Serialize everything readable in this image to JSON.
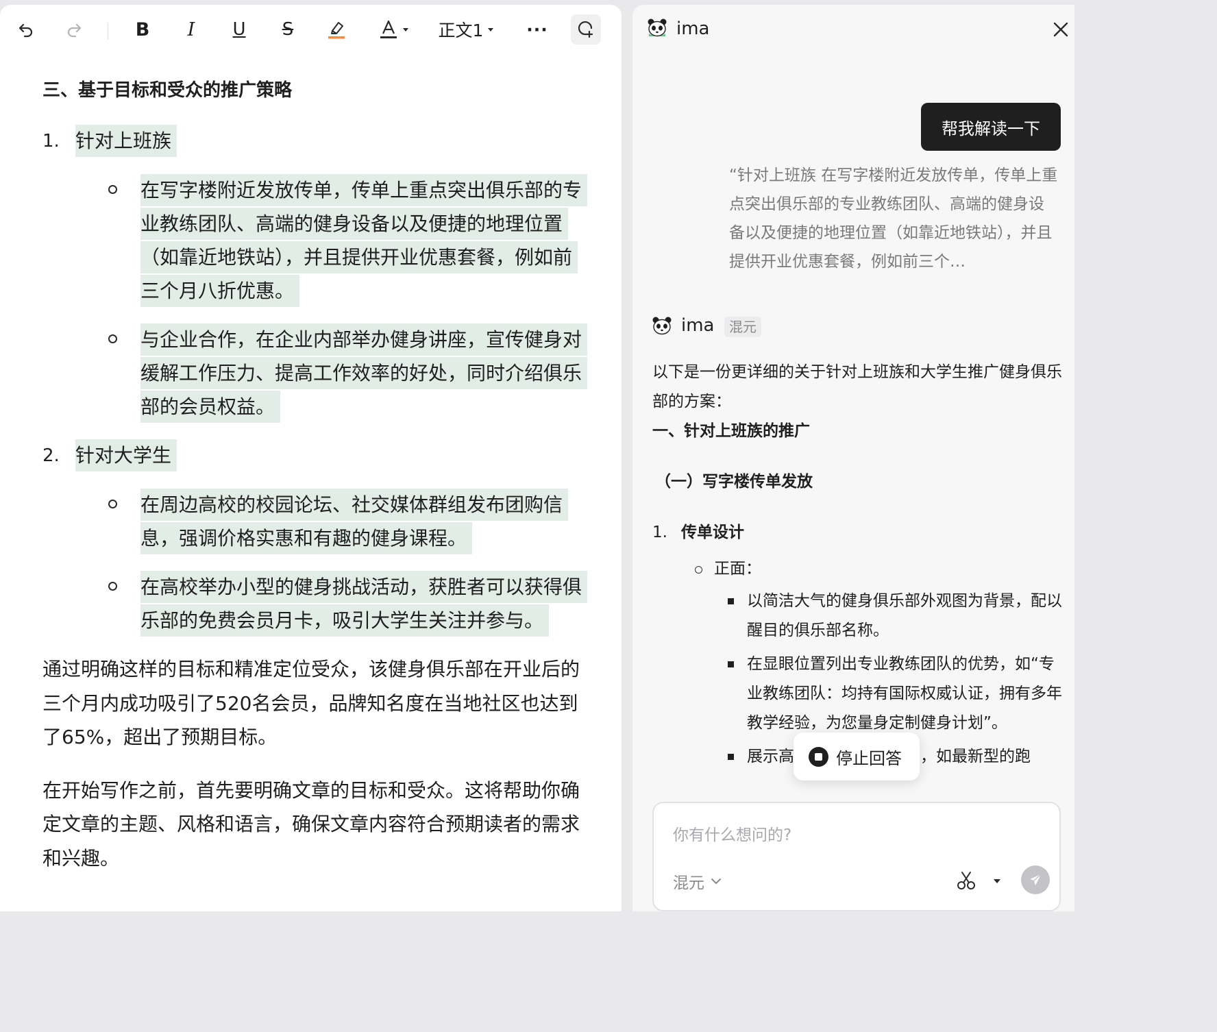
{
  "toolbar": {
    "undo_icon": "undo-icon",
    "redo_icon": "redo-icon",
    "bold_label": "B",
    "italic_label": "I",
    "underline_label": "U",
    "strike_label": "S",
    "style_select": "正文1",
    "more_label": "···",
    "highlight_color": "#ff8a3d"
  },
  "document": {
    "heading": "三、基于目标和受众的推广策略",
    "sections": [
      {
        "number": "1.",
        "title": "针对上班族",
        "items": [
          "在写字楼附近发放传单，传单上重点突出俱乐部的专业教练团队、高端的健身设备以及便捷的地理位置（如靠近地铁站），并且提供开业优惠套餐，例如前三个月八折优惠。",
          "与企业合作，在企业内部举办健身讲座，宣传健身对缓解工作压力、提高工作效率的好处，同时介绍俱乐部的会员权益。"
        ]
      },
      {
        "number": "2.",
        "title": "针对大学生",
        "items": [
          "在周边高校的校园论坛、社交媒体群组发布团购信息，强调价格实惠和有趣的健身课程。",
          "在高校举办小型的健身挑战活动，获胜者可以获得俱乐部的免费会员月卡，吸引大学生关注并参与。"
        ]
      }
    ],
    "paragraphs": [
      "通过明确这样的目标和精准定位受众，该健身俱乐部在开业后的三个月内成功吸引了520名会员，品牌知名度在当地社区也达到了65%，超出了预期目标。",
      "在开始写作之前，首先要明确文章的目标和受众。这将帮助你确定文章的主题、风格和语言，确保文章内容符合预期读者的需求和兴趣。"
    ]
  },
  "assistant": {
    "app_name": "ima",
    "user_message": "帮我解读一下",
    "quoted_text": "“针对上班族 在写字楼附近发放传单，传单上重点突出俱乐部的专业教练团队、高端的健身设备以及便捷的地理位置（如靠近地铁站），并且提供开业优惠套餐，例如前三个…",
    "responder_name": "ima",
    "model_tag": "混元",
    "answer": {
      "intro": "以下是一份更详细的关于针对上班族和大学生推广健身俱乐部的方案：",
      "h1": "一、针对上班族的推广",
      "h2": "（一）写字楼传单发放",
      "item_number": "1.",
      "item_title": "传单设计",
      "sub_label": "正面：",
      "bullets": [
        "以简洁大气的健身俱乐部外观图为背景，配以醒目的俱乐部名称。",
        "在显眼位置列出专业教练团队的优势，如“专业教练团队：均持有国际权威认证，拥有多年教学经验，为您量身定制健身计划”。",
        "展示高端健身设备的图片，如最新型的跑"
      ]
    },
    "stop_label": "停止回答",
    "input_placeholder": "你有什么想问的?",
    "model_select": "混元"
  }
}
